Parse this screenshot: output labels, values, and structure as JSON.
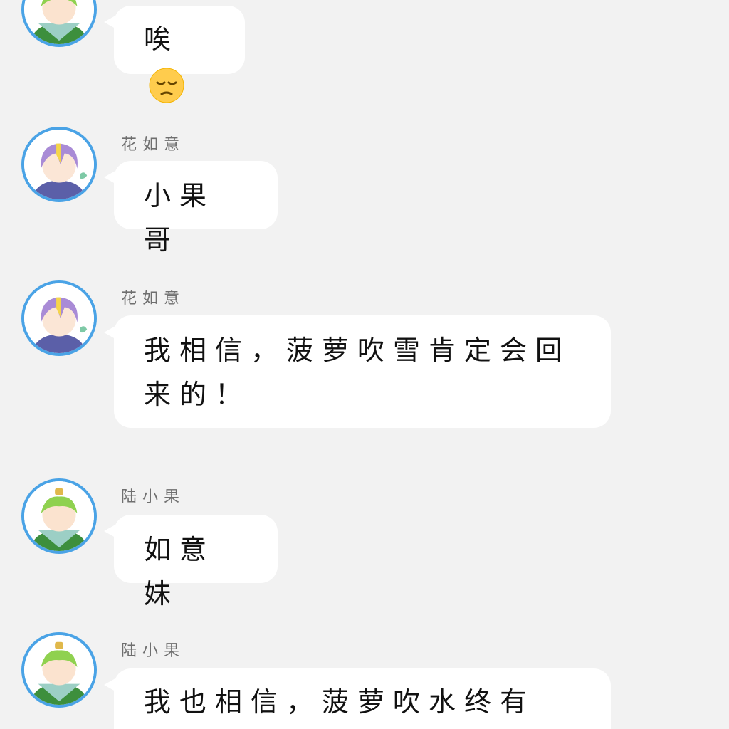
{
  "messages": [
    {
      "sender": "",
      "avatar": "green-hair-avatar",
      "text": "唉",
      "emoji": "pensive-face-emoji"
    },
    {
      "sender": "花如意",
      "avatar": "purple-hair-avatar",
      "text": "小果哥"
    },
    {
      "sender": "花如意",
      "avatar": "purple-hair-avatar",
      "text": "我相信，菠萝吹雪肯定会回来的！"
    },
    {
      "sender": "陆小果",
      "avatar": "green-hair-avatar",
      "text": "如意妹"
    },
    {
      "sender": "陆小果",
      "avatar": "green-hair-avatar",
      "text": "我也相信，菠萝吹水终有"
    }
  ],
  "colors": {
    "background": "#f2f2f2",
    "bubble": "#ffffff",
    "avatar_ring": "#4aa3e6",
    "sender_text": "#6f6f6f"
  }
}
